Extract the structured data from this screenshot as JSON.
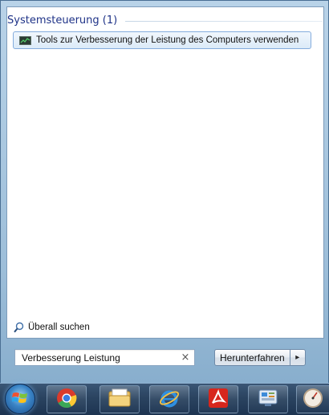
{
  "start_menu": {
    "group_title": "Systemsteuerung (1)",
    "result_item": {
      "label": "Tools zur Verbesserung der Leistung des Computers verwenden",
      "icon": "performance-tools-icon"
    },
    "search_all_label": "Überall suchen",
    "search": {
      "value": "Verbesserung Leistung",
      "clear_glyph": "×"
    },
    "shutdown_label": "Herunterfahren",
    "shutdown_arrow_glyph": "▸"
  },
  "taskbar": {
    "items": [
      {
        "name": "start-orb",
        "icon": "windows-logo-icon"
      },
      {
        "name": "chrome",
        "icon": "chrome-icon"
      },
      {
        "name": "explorer",
        "icon": "folder-icon"
      },
      {
        "name": "internet-explorer",
        "icon": "internet-explorer-icon"
      },
      {
        "name": "adobe-reader",
        "icon": "adobe-reader-icon"
      },
      {
        "name": "control-panel",
        "icon": "control-panel-icon"
      },
      {
        "name": "clock-gadget",
        "icon": "gauge-icon"
      }
    ]
  },
  "colors": {
    "group_title": "#1e3287",
    "selection_border": "#84acdd",
    "taskbar": "#2a4360"
  }
}
